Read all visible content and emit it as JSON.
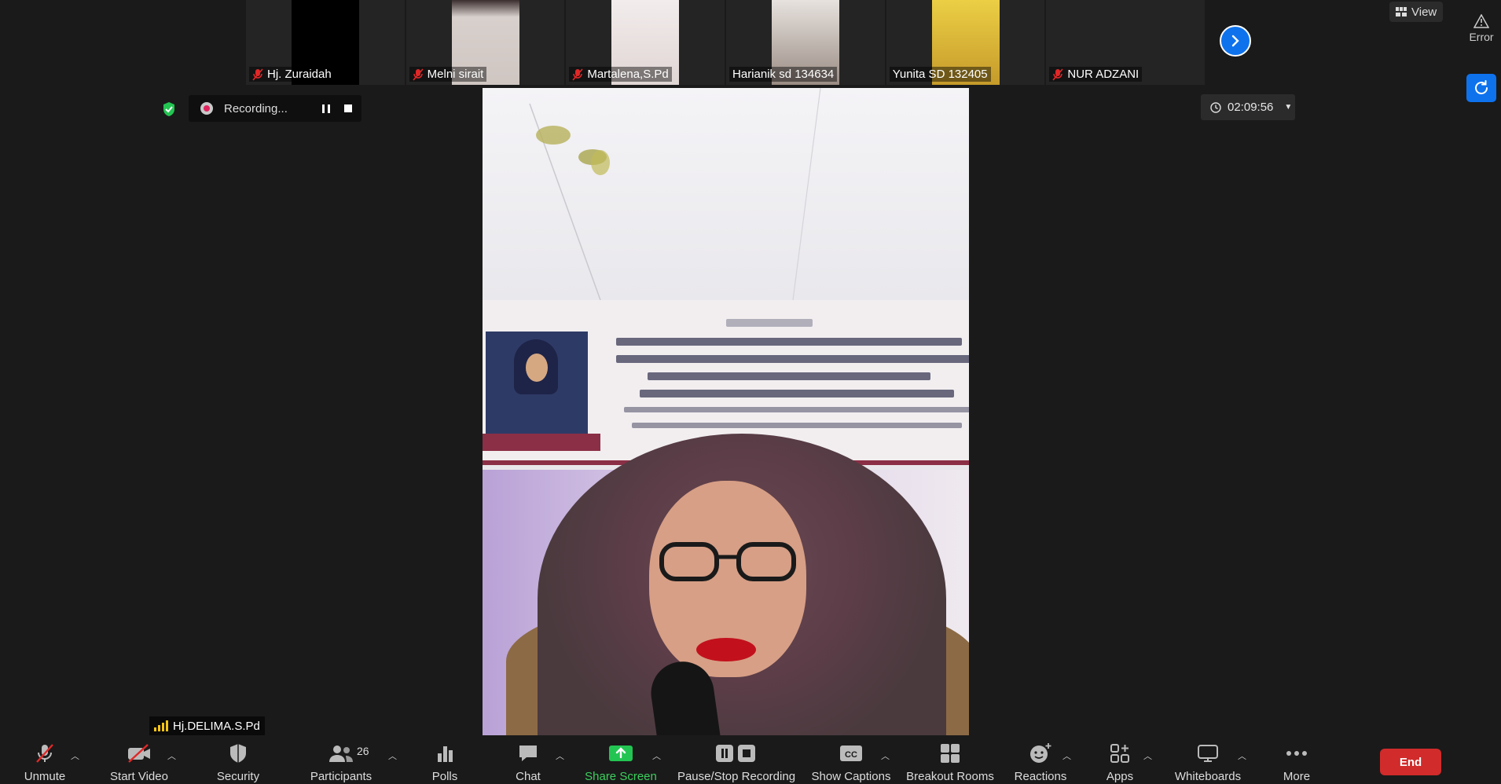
{
  "gallery": [
    {
      "name": "Hj. Zuraidah",
      "muted": true,
      "cam": "#000000"
    },
    {
      "name": "Melni sirait",
      "muted": true,
      "cam": "#d8d0cc"
    },
    {
      "name": "Martalena,S.Pd",
      "muted": true,
      "cam": "#ece4e4"
    },
    {
      "name": "Harianik sd 134634",
      "muted": false,
      "cam": "#c9c2bb"
    },
    {
      "name": "Yunita SD 132405",
      "muted": false,
      "cam": "#e8c63c"
    },
    {
      "name": "NUR ADZANI",
      "muted": true,
      "cam": "#242424"
    }
  ],
  "top_right": {
    "view_label": "View",
    "error_label": "Error"
  },
  "recording": {
    "status": "Recording..."
  },
  "timer": {
    "value": "02:09:56"
  },
  "speaker": {
    "name": "Hj.DELIMA.S.Pd"
  },
  "banner_text": [
    "WALIKOTA TANJUNGBALAI",
    "BAPAK H. WARIS THALIB, S.Ag.",
    "& KADIS PENDIDIKAN",
    "IBU ... DELIMA, S.Pd. M.M"
  ],
  "toolbar": {
    "unmute": "Unmute",
    "start_video": "Start Video",
    "security": "Security",
    "participants": "Participants",
    "participants_count": "26",
    "polls": "Polls",
    "chat": "Chat",
    "share_screen": "Share Screen",
    "pause_stop_recording": "Pause/Stop Recording",
    "show_captions": "Show Captions",
    "breakout_rooms": "Breakout Rooms",
    "reactions": "Reactions",
    "apps": "Apps",
    "whiteboards": "Whiteboards",
    "more": "More",
    "end": "End"
  },
  "colors": {
    "accent_blue": "#0e72ed",
    "end_red": "#d12b2b",
    "share_green": "#23c552",
    "mute_red": "#e02828"
  }
}
